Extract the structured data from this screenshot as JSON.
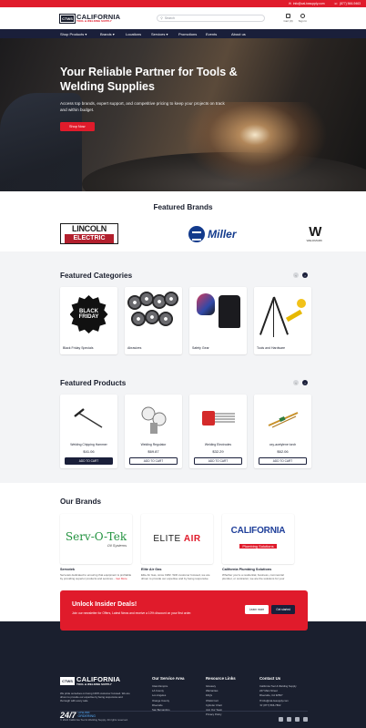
{
  "topbar": {
    "email": "info@cal-twsupply.com",
    "phone": "(877) 566-9463"
  },
  "header": {
    "logo_box": "CTWS",
    "logo_line1": "CALIFORNIA",
    "logo_line2": "TOOL & WELDING SUPPLY",
    "search_placeholder": "Search",
    "cart_label": "Cart (0)",
    "account_label": "Sign In"
  },
  "nav": [
    "Shop Products",
    "Brands",
    "Locations",
    "Services",
    "Promotions",
    "Events",
    "About us"
  ],
  "hero": {
    "title": "Your Reliable Partner for Tools & Welding Supplies",
    "subtitle": "Access top brands, expert support, and competitive pricing to keep your projects on track and within budget.",
    "cta": "Shop Now"
  },
  "featured_brands": {
    "title": "Featured Brands",
    "lincoln_top": "LINCOLN",
    "lincoln_bottom": "ELECTRIC",
    "miller": "Miller",
    "weldmark_mark": "W",
    "weldmark_name": "WELDMARK"
  },
  "categories": {
    "title": "Featured Categories",
    "black_friday": "BLACK FRIDAY",
    "items": [
      "Black Friday Specials",
      "Abrasives",
      "Safety Gear",
      "Tools and Hardware"
    ]
  },
  "products": {
    "title": "Featured Products",
    "items": [
      {
        "name": "Welding Chipping Hammer",
        "price": "$41.06",
        "button": "ADD TO CART"
      },
      {
        "name": "Welding Regulator",
        "price": "$69.87",
        "button": "ADD TO CART"
      },
      {
        "name": "Welding Electrodes",
        "price": "$32.29",
        "button": "ADD TO CART"
      },
      {
        "name": "oxy-acetylene torch",
        "price": "$62.06",
        "button": "ADD TO CART"
      }
    ]
  },
  "our_brands": {
    "title": "Our Brands",
    "items": [
      {
        "logo_a": "Serv-O-Tek",
        "logo_b": "Oil Systems",
        "name": "Servotek",
        "desc": "Servotek dedicated to ensuring that equipment is profitable by providing superior products and services...",
        "more": "Get More"
      },
      {
        "logo_a": "ELITE",
        "logo_b": "AIR",
        "name": "Elite Air Gas",
        "desc": "Elite Air Gas, since 1982. With customer focused, we are driven to provide our expertise and by being responsive and thorough...",
        "more": "Get More"
      },
      {
        "logo_a": "CALIFORNIA",
        "logo_b": "Plumbing Solutions",
        "name": "California Plumbing Solutions",
        "desc": "Whether you're a residential, business, commercial plumber, or contractor, we are the solutions for your business...",
        "more": "Get More"
      }
    ]
  },
  "cta": {
    "title": "Unlock Insider Deals!",
    "text": "Join our newsletter for Offers, Latest News and receive a 10% discount on your first order.",
    "learn_more": "Learn more",
    "get_started": "Get started"
  },
  "footer": {
    "desc": "We pride ourselves on being 100% customer focused. We are driven to provide our expertise by being responsive and thorough with every sale.",
    "online_num": "24/7",
    "online_word1": "ONLINE",
    "online_word2": "ORDERING",
    "cols": [
      {
        "title": "Our Service Area",
        "items": [
          "Inland Empire",
          "LA County",
          "Los Angeles",
          "Orange County",
          "Riverside",
          "San Bernardino"
        ]
      },
      {
        "title": "Resource Links",
        "items": [
          "Glossary",
          "Warranties",
          "FAQs",
          "OSHA Cert",
          "Cylinder Chart",
          "Join Our Team",
          "Privacy Policy"
        ]
      },
      {
        "title": "Contact Us",
        "items": [
          "California Tool & Welding Supply",
          "247 Main Street",
          "Riverside, CA 92507",
          "info@cal-twsupply.com",
          "(877) 566-7802"
        ]
      }
    ],
    "copyright": "© 2024 California Tool & Welding Supply. All rights reserved."
  },
  "colors": {
    "brand_red": "#e01b2b",
    "navy": "#1a1f3a",
    "footer": "#1a1f2e"
  }
}
